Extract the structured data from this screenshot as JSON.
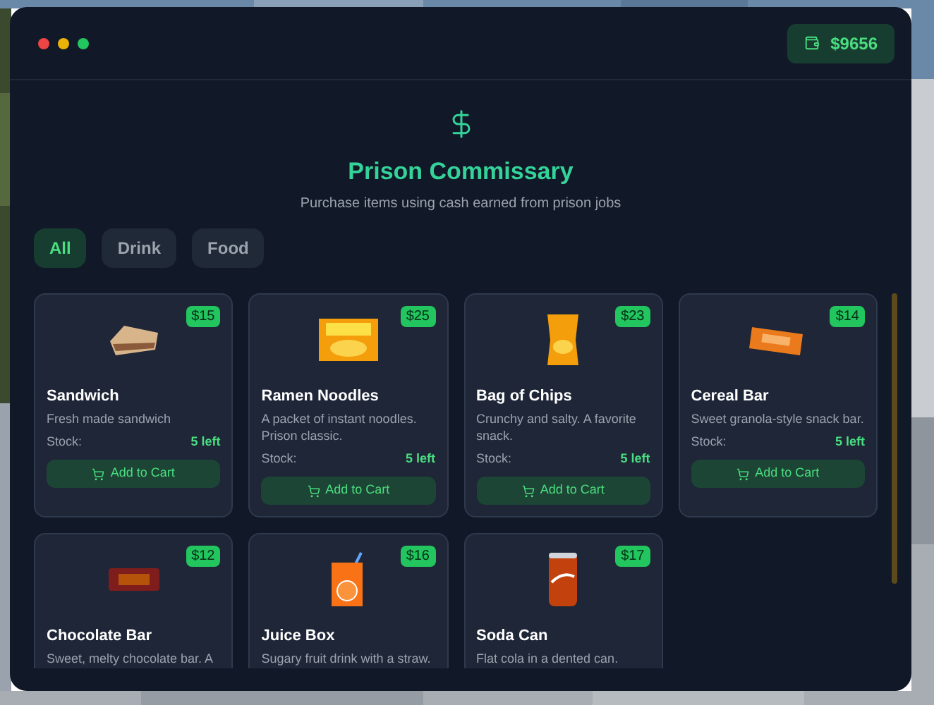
{
  "balance": "$9656",
  "header": {
    "title": "Prison Commissary",
    "subtitle": "Purchase items using cash earned from prison jobs"
  },
  "tabs": [
    {
      "label": "All",
      "selected": true
    },
    {
      "label": "Drink",
      "selected": false
    },
    {
      "label": "Food",
      "selected": false
    }
  ],
  "items": [
    {
      "kind": "sandwich",
      "name": "Sandwich",
      "price": "$15",
      "description": "Fresh made sandwich",
      "stock_label": "Stock:",
      "stock": "5 left",
      "button": "Add to Cart"
    },
    {
      "kind": "noodles",
      "name": "Ramen Noodles",
      "price": "$25",
      "description": "A packet of instant noodles. Prison classic.",
      "stock_label": "Stock:",
      "stock": "5 left",
      "button": "Add to Cart"
    },
    {
      "kind": "chips",
      "name": "Bag of Chips",
      "price": "$23",
      "description": "Crunchy and salty. A favorite snack.",
      "stock_label": "Stock:",
      "stock": "5 left",
      "button": "Add to Cart"
    },
    {
      "kind": "cereal",
      "name": "Cereal Bar",
      "price": "$14",
      "description": "Sweet granola-style snack bar.",
      "stock_label": "Stock:",
      "stock": "5 left",
      "button": "Add to Cart"
    },
    {
      "kind": "chocolate",
      "name": "Chocolate Bar",
      "price": "$12",
      "description": "Sweet, melty chocolate bar. A"
    },
    {
      "kind": "juice",
      "name": "Juice Box",
      "price": "$16",
      "description": "Sugary fruit drink with a straw."
    },
    {
      "kind": "soda",
      "name": "Soda Can",
      "price": "$17",
      "description": "Flat cola in a dented can."
    }
  ]
}
